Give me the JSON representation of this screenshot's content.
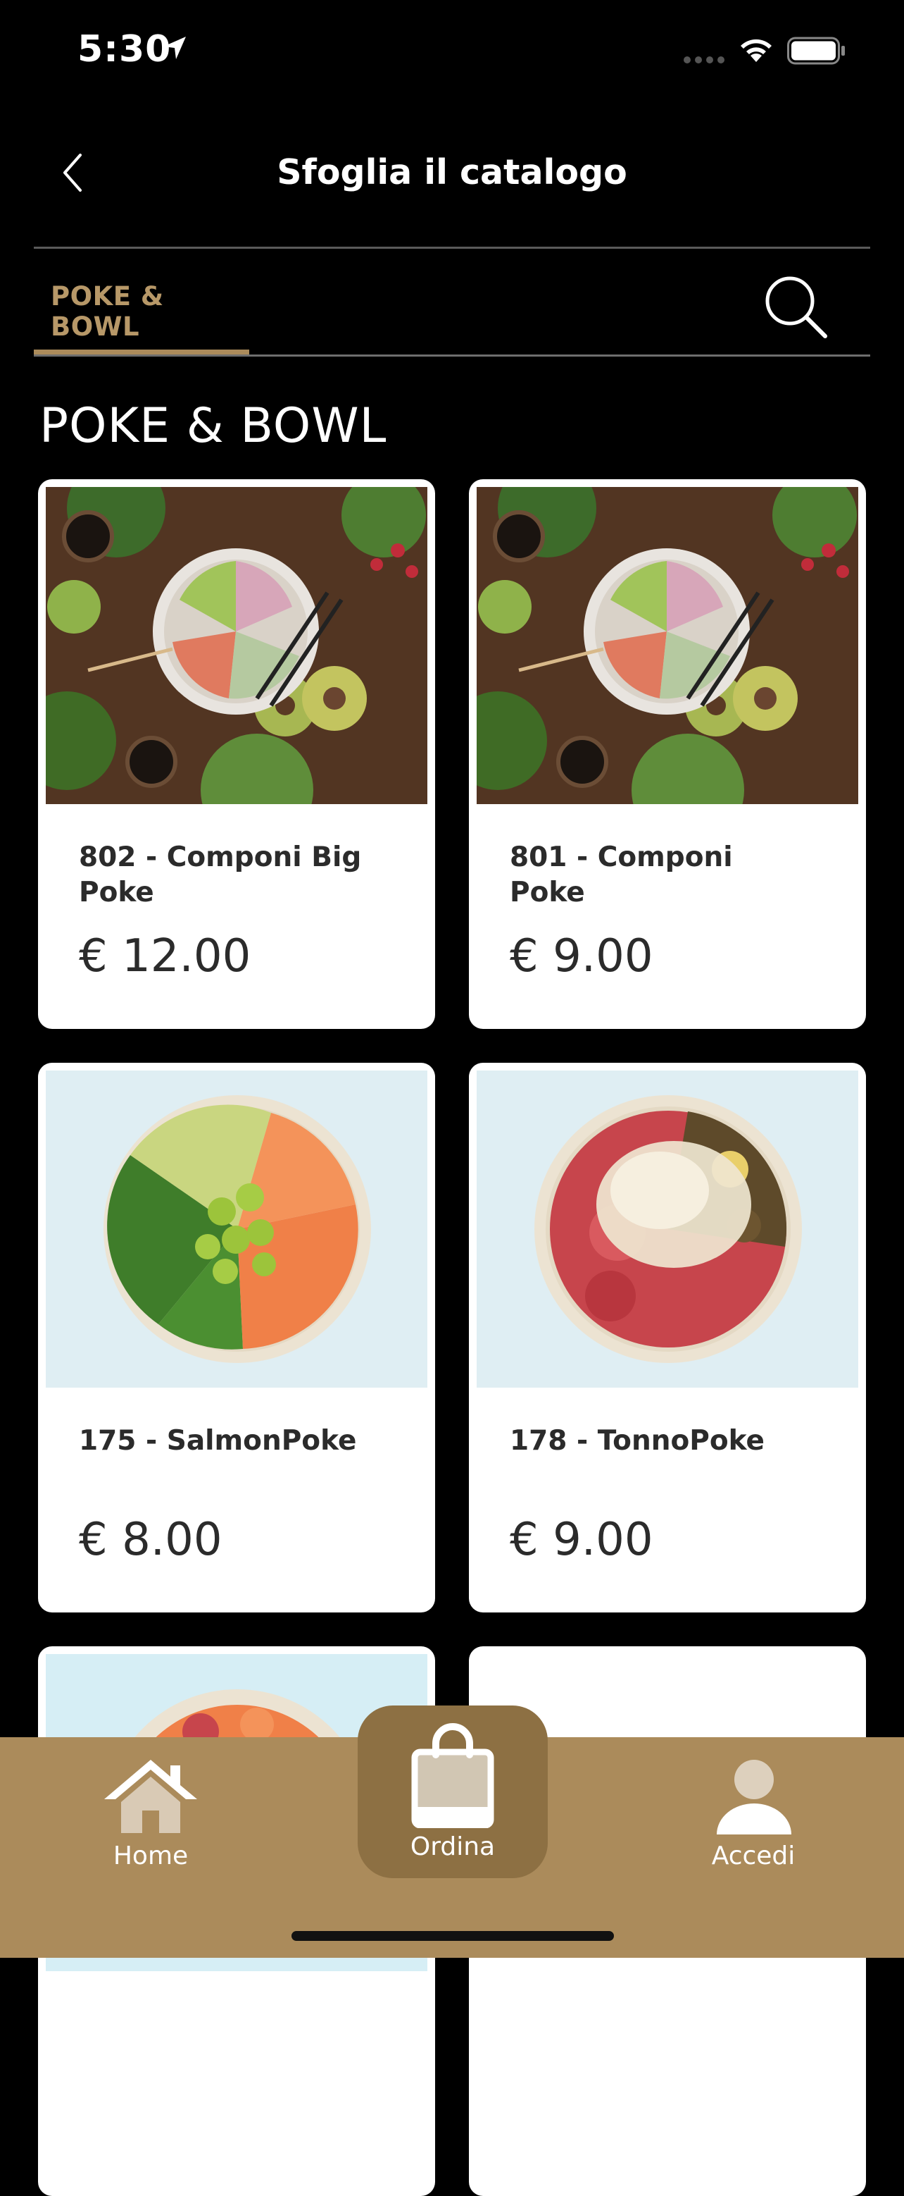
{
  "status_bar": {
    "time": "5:30"
  },
  "header": {
    "title": "Sfoglia il catalogo"
  },
  "tabs": [
    {
      "label": "POKE & BOWL",
      "active": true
    }
  ],
  "section": {
    "title": "POKE & BOWL"
  },
  "products": [
    {
      "name": "802 - Componi Big Poke",
      "price": "€ 12.00",
      "image": "poke-bowl-overhead-photo"
    },
    {
      "name": "801 - Componi Poke",
      "price": "€ 9.00",
      "image": "poke-bowl-overhead-photo"
    },
    {
      "name": "175 - SalmonPoke",
      "price": "€ 8.00",
      "image": "salmon-poke-bowl-photo"
    },
    {
      "name": "178 - TonnoPoke",
      "price": "€ 9.00",
      "image": "tuna-poke-bowl-photo"
    }
  ],
  "bottom_nav": {
    "home": "Home",
    "order": "Ordina",
    "login": "Accedi"
  },
  "colors": {
    "accent": "#ab8b5b",
    "accent_dark": "#8d7043",
    "background": "#000000",
    "card": "#ffffff"
  },
  "icons": [
    "location-arrow-icon",
    "signal-icon",
    "wifi-icon",
    "battery-icon",
    "back-chevron-icon",
    "search-icon",
    "home-icon",
    "shopping-bag-icon",
    "user-icon"
  ]
}
